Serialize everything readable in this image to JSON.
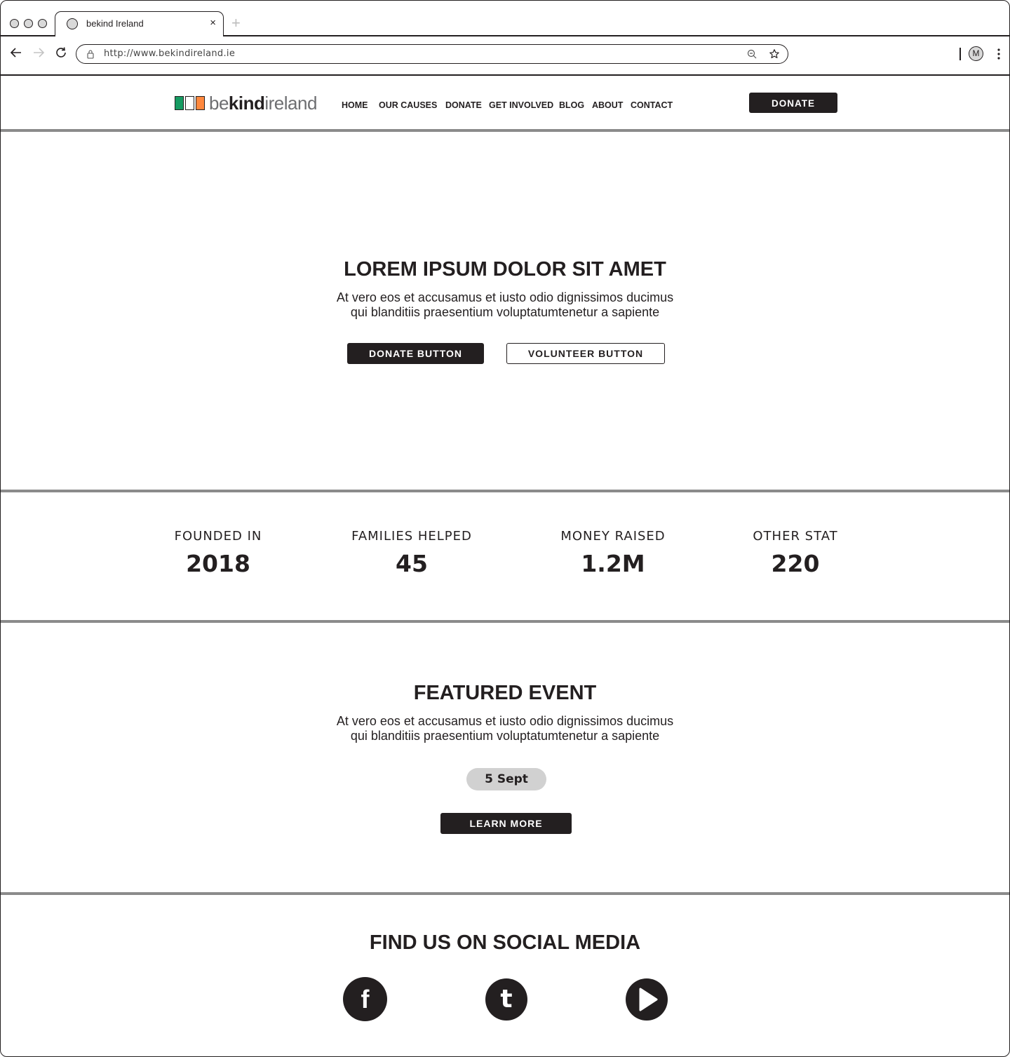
{
  "browser": {
    "tab_title": "bekind Ireland",
    "tab_close": "×",
    "new_tab": "+",
    "url": "http://www.bekindireland.ie",
    "profile_initial": "M"
  },
  "header": {
    "logo": {
      "prefix": "be",
      "bold": "kind",
      "suffix": "ireland",
      "flag_colors": [
        "#169b62",
        "#ffffff",
        "#ff883e"
      ]
    },
    "nav": [
      "HOME",
      "OUR CAUSES",
      "DONATE",
      "GET INVOLVED",
      "BLOG",
      "ABOUT",
      "CONTACT"
    ],
    "donate_button": "DONATE"
  },
  "hero": {
    "title": "LOREM IPSUM DOLOR SIT AMET",
    "text_line1": "At vero eos et accusamus et iusto odio dignissimos ducimus",
    "text_line2": "qui blanditiis praesentium voluptatumtenetur a sapiente",
    "donate_button": "DONATE BUTTON",
    "volunteer_button": "VOLUNTEER BUTTON"
  },
  "stats": [
    {
      "label": "FOUNDED IN",
      "value": "2018"
    },
    {
      "label": "FAMILIES HELPED",
      "value": "45"
    },
    {
      "label": "MONEY RAISED",
      "value": "1.2M"
    },
    {
      "label": "OTHER STAT",
      "value": "220"
    }
  ],
  "event": {
    "title": "FEATURED EVENT",
    "text_line1": "At vero eos et accusamus et iusto odio dignissimos ducimus",
    "text_line2": "qui blanditiis praesentium voluptatumtenetur a sapiente",
    "date": "5 Sept",
    "learn_more": "LEARN MORE"
  },
  "social": {
    "title": "FIND US ON SOCIAL MEDIA",
    "icons": [
      "facebook-icon",
      "tumblr-icon",
      "youtube-icon"
    ],
    "facebook_glyph": "f",
    "tumblr_glyph": "t"
  },
  "colors": {
    "dark": "#231f20",
    "divider": "#8b8b8b",
    "pill": "#d1d1d1"
  }
}
